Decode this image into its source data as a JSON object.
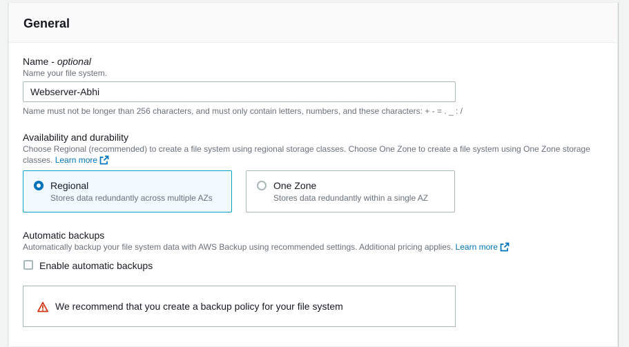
{
  "panel": {
    "title": "General"
  },
  "name_field": {
    "label": "Name",
    "label_suffix": "optional",
    "description": "Name your file system.",
    "value": "Webserver-Abhi",
    "constraint": "Name must not be longer than 256 characters, and must only contain letters, numbers, and these characters: + - = . _ : /"
  },
  "availability": {
    "label": "Availability and durability",
    "description": "Choose Regional (recommended) to create a file system using regional storage classes. Choose One Zone to create a file system using One Zone storage classes.",
    "learn_more": "Learn more",
    "options": [
      {
        "title": "Regional",
        "description": "Stores data redundantly across multiple AZs",
        "selected": true
      },
      {
        "title": "One Zone",
        "description": "Stores data redundantly within a single AZ",
        "selected": false
      }
    ]
  },
  "backups": {
    "label": "Automatic backups",
    "description": "Automatically backup your file system data with AWS Backup using recommended settings. Additional pricing applies.",
    "learn_more": "Learn more",
    "checkbox_label": "Enable automatic backups",
    "checked": false
  },
  "alert": {
    "icon": "warning-icon",
    "message": "We recommend that you create a backup policy for your file system"
  },
  "colors": {
    "link": "#0073bb",
    "selected_border": "#00a1c9",
    "selected_bg": "#f1faff",
    "warning": "#d13212"
  }
}
